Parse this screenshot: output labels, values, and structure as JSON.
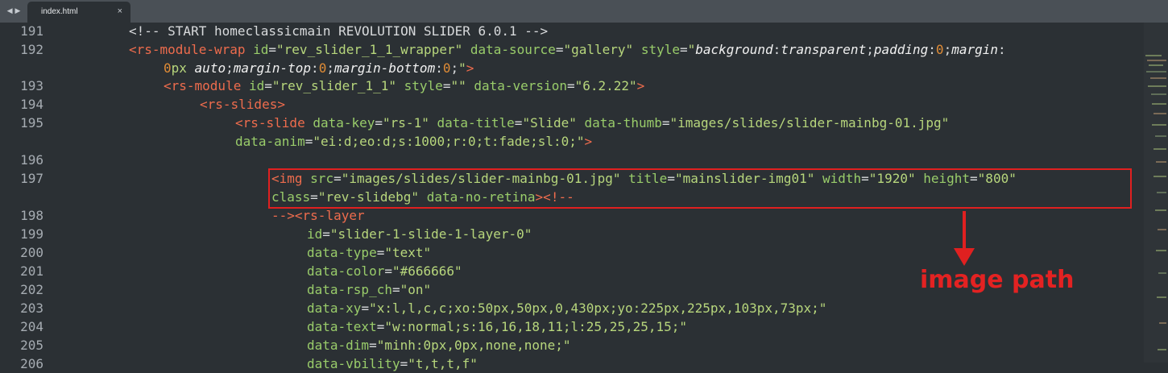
{
  "tabbar": {
    "nav_back": "◀",
    "nav_forward": "▶",
    "tab": {
      "title": "index.html",
      "close": "×"
    }
  },
  "gutter": {
    "line_numbers": [
      "191",
      "192",
      "",
      "193",
      "194",
      "195",
      "",
      "196",
      "197",
      "",
      "198",
      "199",
      "200",
      "201",
      "202",
      "203",
      "204",
      "205",
      "206"
    ]
  },
  "code": {
    "l191": {
      "text": "<!-- START homeclassicmain REVOLUTION SLIDER 6.0.1 -->"
    },
    "l192": {
      "t1": "<rs-module-wrap ",
      "a1": "id",
      "s1": "\"rev_slider_1_1_wrapper\"",
      "a2": "data-source",
      "s2": "\"gallery\"",
      "a3": "style",
      "q": "\"",
      "i1": "background",
      "i1v": "transparent",
      "i2": "padding",
      "n0": "0",
      "i3": "margin"
    },
    "l192b": {
      "n0": "0",
      "px": "px ",
      "auto": "auto",
      "i1": "margin-top",
      "n1": "0",
      "i2": "margin-bottom",
      "n2": "0",
      "end": ">"
    },
    "l193": {
      "t1": "<rs-module ",
      "a1": "id",
      "s1": "\"rev_slider_1_1\"",
      "a2": "style",
      "s2": "\"\"",
      "a3": "data-version",
      "s3": "\"6.2.22\"",
      "end": ">"
    },
    "l194": {
      "t1": "<rs-slides>"
    },
    "l195": {
      "t1": "<rs-slide ",
      "a1": "data-key",
      "s1": "\"rs-1\"",
      "a2": "data-title",
      "s2": "\"Slide\"",
      "a3": "data-thumb",
      "s3": "\"images/slides/slider-mainbg-01.jpg\""
    },
    "l195b": {
      "a1": "data-anim",
      "s1": "\"ei:d;eo:d;s:1000;r:0;t:fade;sl:0;\"",
      "end": ">"
    },
    "l197": {
      "t1": "<img ",
      "a1": "src",
      "s1": "\"images/slides/slider-mainbg-01.jpg\"",
      "a2": "title",
      "s2": "\"mainslider-img01\"",
      "a3": "width",
      "s3": "\"1920\"",
      "a4": "height",
      "s4": "\"800\""
    },
    "l197b": {
      "a1": "class",
      "s1": "\"rev-slidebg\"",
      "a2": "data-no-retina",
      "end": "><!--"
    },
    "l198": {
      "t0": "-->",
      "t1": "<rs-layer"
    },
    "l199": {
      "a": "id",
      "s": "\"slider-1-slide-1-layer-0\""
    },
    "l200": {
      "a": "data-type",
      "s": "\"text\""
    },
    "l201": {
      "a": "data-color",
      "s": "\"#666666\""
    },
    "l202": {
      "a": "data-rsp_ch",
      "s": "\"on\""
    },
    "l203": {
      "a": "data-xy",
      "s": "\"x:l,l,c,c;xo:50px,50px,0,430px;yo:225px,225px,103px,73px;\""
    },
    "l204": {
      "a": "data-text",
      "s": "\"w:normal;s:16,16,18,11;l:25,25,25,15;\""
    },
    "l205": {
      "a": "data-dim",
      "s": "\"minh:0px,0px,none,none;\""
    },
    "l206": {
      "a": "data-vbility",
      "s": "\"t,t,t,f\""
    }
  },
  "annotation": {
    "label": "image path"
  },
  "colors": {
    "background": "#2b3034",
    "tag": "#ee6c4d",
    "attribute": "#99cc6a",
    "string": "#b7d67c",
    "number": "#e08c36",
    "annotation_red": "#e02020"
  }
}
